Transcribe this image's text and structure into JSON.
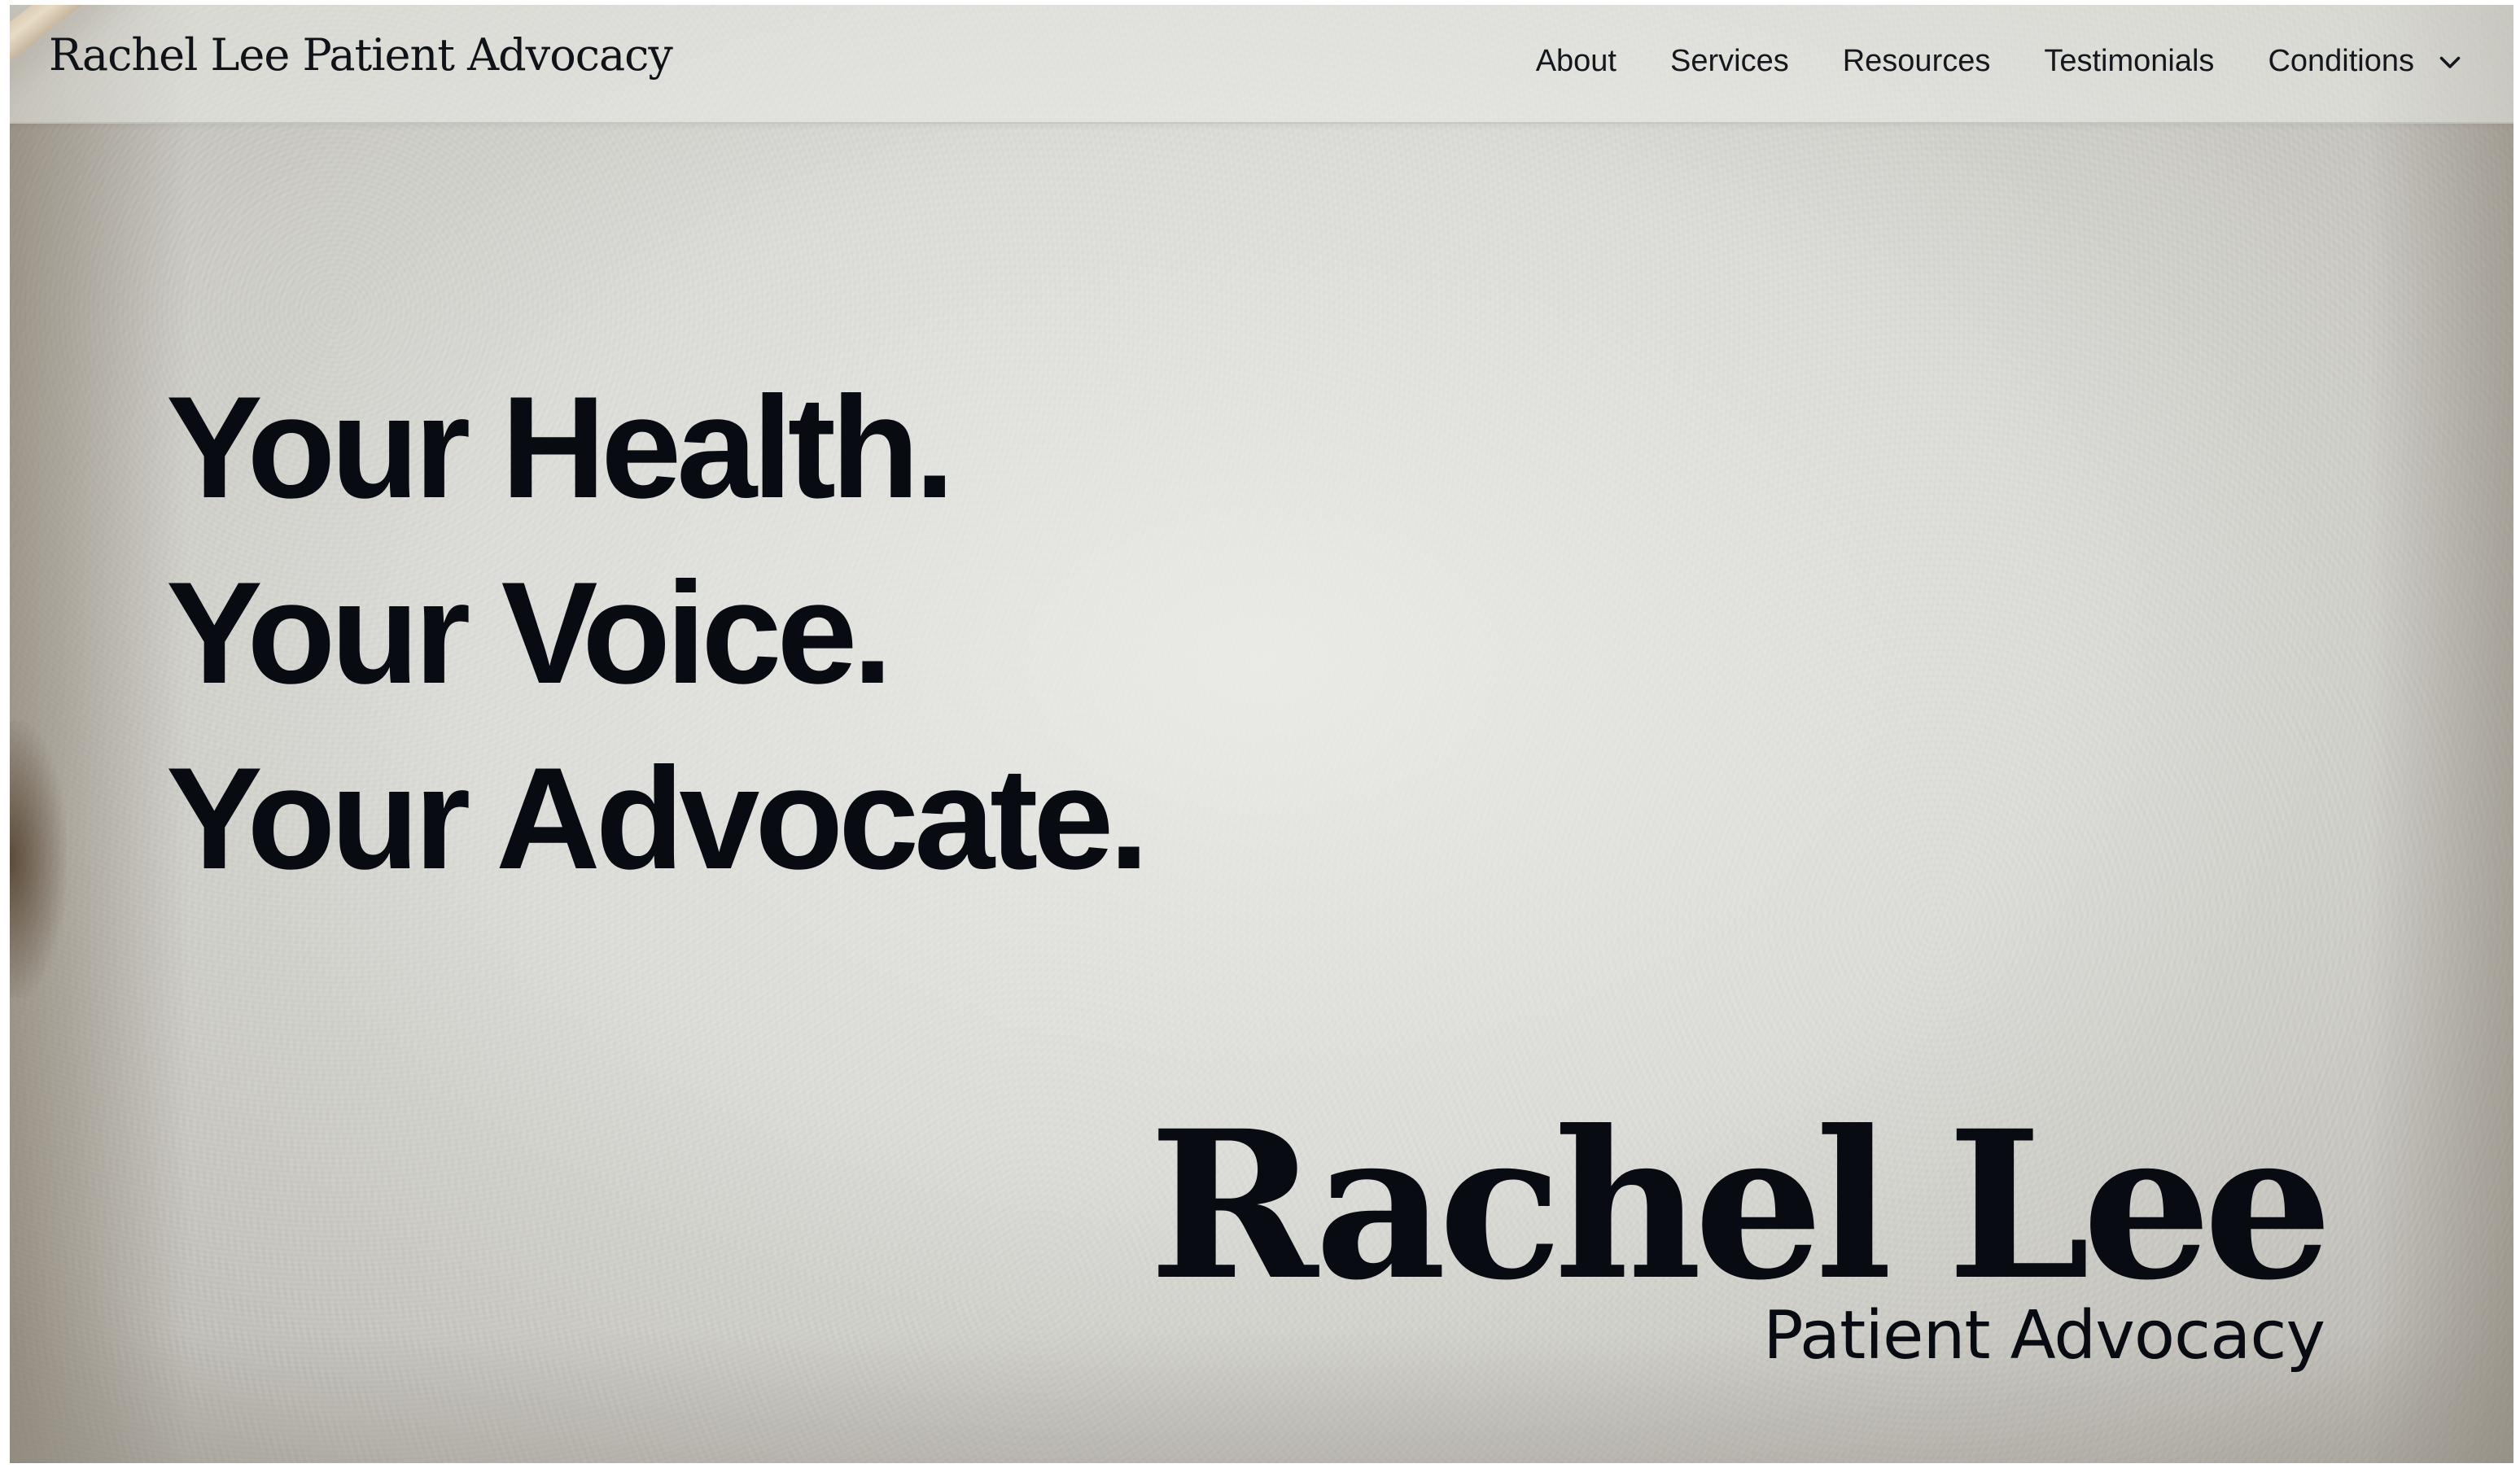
{
  "header": {
    "brand": "Rachel Lee Patient Advocacy",
    "nav": [
      {
        "label": "About"
      },
      {
        "label": "Services"
      },
      {
        "label": "Resources"
      },
      {
        "label": "Testimonials"
      }
    ],
    "dropdown": {
      "label": "Conditions",
      "icon": "chevron-down-icon"
    }
  },
  "hero": {
    "lines": [
      "Your Health.",
      "Your Voice.",
      "Your Advocate."
    ]
  },
  "logo": {
    "name": "Rachel Lee",
    "subtitle": "Patient Advocacy"
  },
  "colors": {
    "text": "#080b12",
    "background": "#d8d9d4",
    "accent_wood": "#c9a574"
  }
}
